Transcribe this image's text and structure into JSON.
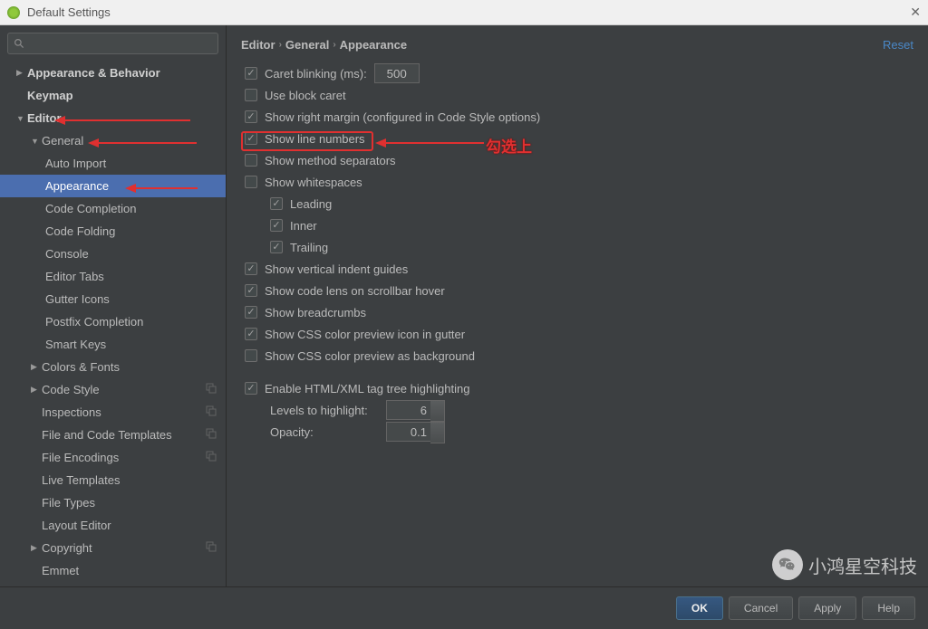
{
  "window": {
    "title": "Default Settings"
  },
  "breadcrumb": {
    "parts": [
      "Editor",
      "General",
      "Appearance"
    ],
    "reset": "Reset"
  },
  "sidebar": {
    "items": [
      {
        "label": "Appearance & Behavior",
        "depth": 0,
        "arrow": "▶",
        "bold": true
      },
      {
        "label": "Keymap",
        "depth": 0,
        "arrow": "",
        "bold": true,
        "noarrow": true
      },
      {
        "label": "Editor",
        "depth": 0,
        "arrow": "▼",
        "bold": true
      },
      {
        "label": "General",
        "depth": 1,
        "arrow": "▼"
      },
      {
        "label": "Auto Import",
        "depth": 2
      },
      {
        "label": "Appearance",
        "depth": 2,
        "selected": true
      },
      {
        "label": "Code Completion",
        "depth": 2
      },
      {
        "label": "Code Folding",
        "depth": 2
      },
      {
        "label": "Console",
        "depth": 2
      },
      {
        "label": "Editor Tabs",
        "depth": 2
      },
      {
        "label": "Gutter Icons",
        "depth": 2
      },
      {
        "label": "Postfix Completion",
        "depth": 2
      },
      {
        "label": "Smart Keys",
        "depth": 2
      },
      {
        "label": "Colors & Fonts",
        "depth": 1,
        "arrow": "▶"
      },
      {
        "label": "Code Style",
        "depth": 1,
        "arrow": "▶",
        "copy": true
      },
      {
        "label": "Inspections",
        "depth": 1,
        "arrow": "",
        "noarrow": true,
        "copy": true
      },
      {
        "label": "File and Code Templates",
        "depth": 1,
        "arrow": "",
        "noarrow": true,
        "copy": true
      },
      {
        "label": "File Encodings",
        "depth": 1,
        "arrow": "",
        "noarrow": true,
        "copy": true
      },
      {
        "label": "Live Templates",
        "depth": 1,
        "arrow": "",
        "noarrow": true
      },
      {
        "label": "File Types",
        "depth": 1,
        "arrow": "",
        "noarrow": true
      },
      {
        "label": "Layout Editor",
        "depth": 1,
        "arrow": "",
        "noarrow": true
      },
      {
        "label": "Copyright",
        "depth": 1,
        "arrow": "▶",
        "copy": true
      },
      {
        "label": "Emmet",
        "depth": 1,
        "arrow": "",
        "noarrow": true
      }
    ]
  },
  "options": {
    "caret_label": "Caret blinking (ms):",
    "caret_value": "500",
    "block_caret": "Use block caret",
    "right_margin": "Show right margin (configured in Code Style options)",
    "line_numbers": "Show line numbers",
    "method_sep": "Show method separators",
    "whitespaces": "Show whitespaces",
    "leading": "Leading",
    "inner": "Inner",
    "trailing": "Trailing",
    "indent_guides": "Show vertical indent guides",
    "code_lens": "Show code lens on scrollbar hover",
    "breadcrumbs": "Show breadcrumbs",
    "css_gutter": "Show CSS color preview icon in gutter",
    "css_bg": "Show CSS color preview as background",
    "html_tag": "Enable HTML/XML tag tree highlighting",
    "levels_label": "Levels to highlight:",
    "levels_value": "6",
    "opacity_label": "Opacity:",
    "opacity_value": "0.1"
  },
  "annotation": {
    "text": "勾选上"
  },
  "footer": {
    "ok": "OK",
    "cancel": "Cancel",
    "apply": "Apply",
    "help": "Help"
  },
  "watermark": {
    "text": "小鸿星空科技"
  }
}
